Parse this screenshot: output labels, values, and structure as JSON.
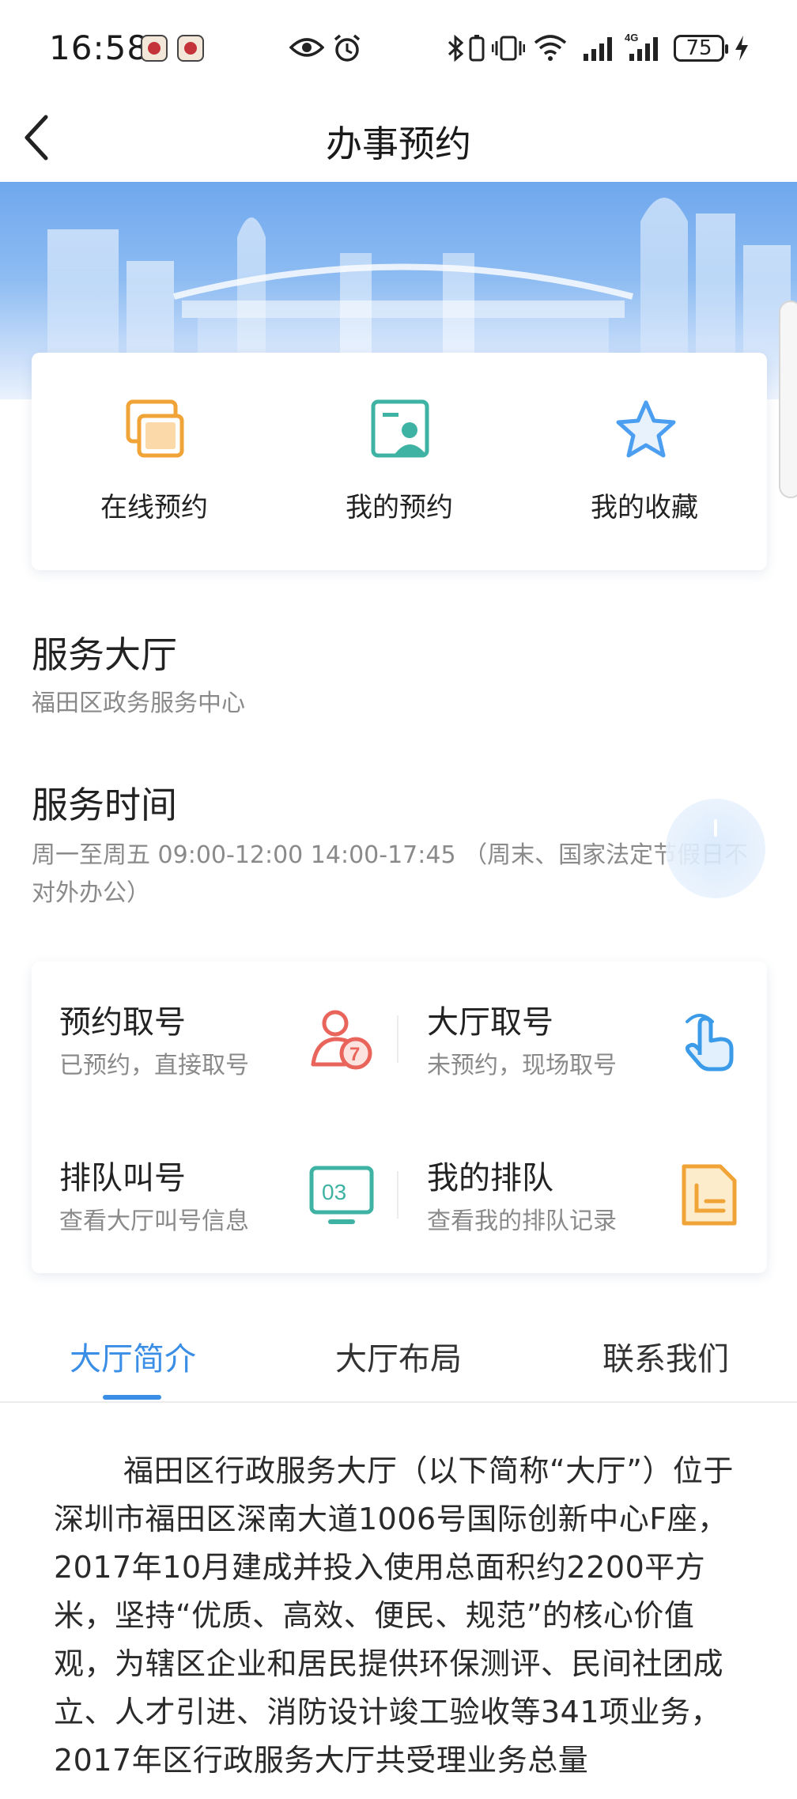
{
  "status_bar": {
    "time": "16:58",
    "battery": "75",
    "icons": [
      "app-notification-icon",
      "app-notification-icon",
      "eye-icon",
      "alarm-icon",
      "bluetooth-icon",
      "vibrate-icon",
      "wifi-icon",
      "signal-icon",
      "4g-signal-icon",
      "battery-icon",
      "charging-icon"
    ]
  },
  "nav": {
    "title": "办事预约",
    "back_icon": "chevron-left-icon"
  },
  "quick_actions": [
    {
      "label": "在线预约",
      "icon": "online-booking-icon",
      "color": "#f0a336"
    },
    {
      "label": "我的预约",
      "icon": "my-booking-icon",
      "color": "#3fb3a3"
    },
    {
      "label": "我的收藏",
      "icon": "star-icon",
      "color": "#4b9ef0"
    }
  ],
  "hall": {
    "title": "服务大厅",
    "name": "福田区政务服务中心"
  },
  "hours": {
    "title": "服务时间",
    "text": "周一至周五 09:00-12:00 14:00-17:45 （周末、国家法定节假日不对外办公）"
  },
  "queue": [
    {
      "title": "预约取号",
      "sub": "已预约，直接取号",
      "icon": "take-number-icon",
      "color": "#e9655b"
    },
    {
      "title": "大厅取号",
      "sub": "未预约，现场取号",
      "icon": "tap-hand-icon",
      "color": "#3c9be8"
    },
    {
      "title": "排队叫号",
      "sub": "查看大厅叫号信息",
      "icon": "monitor-number-icon",
      "icon_text": "03",
      "color": "#3fb3a3"
    },
    {
      "title": "我的排队",
      "sub": "查看我的排队记录",
      "icon": "queue-record-icon",
      "color": "#f0a336"
    }
  ],
  "tabs": [
    {
      "label": "大厅简介",
      "active": true
    },
    {
      "label": "大厅布局",
      "active": false
    },
    {
      "label": "联系我们",
      "active": false
    }
  ],
  "intro": "福田区行政服务大厅（以下简称“大厅”）位于深圳市福田区深南大道1006号国际创新中心F座，2017年10月建成并投入使用总面积约2200平方米，坚持“优质、高效、便民、规范”的核心价值观，为辖区企业和居民提供环保测评、民间社团成立、人才引进、消防设计竣工验收等341项业务，2017年区行政服务大厅共受理业务总量",
  "colors": {
    "accent": "#3a8ee6",
    "banner_top": "#6fa8ee",
    "text_secondary": "#8a8a8a"
  }
}
